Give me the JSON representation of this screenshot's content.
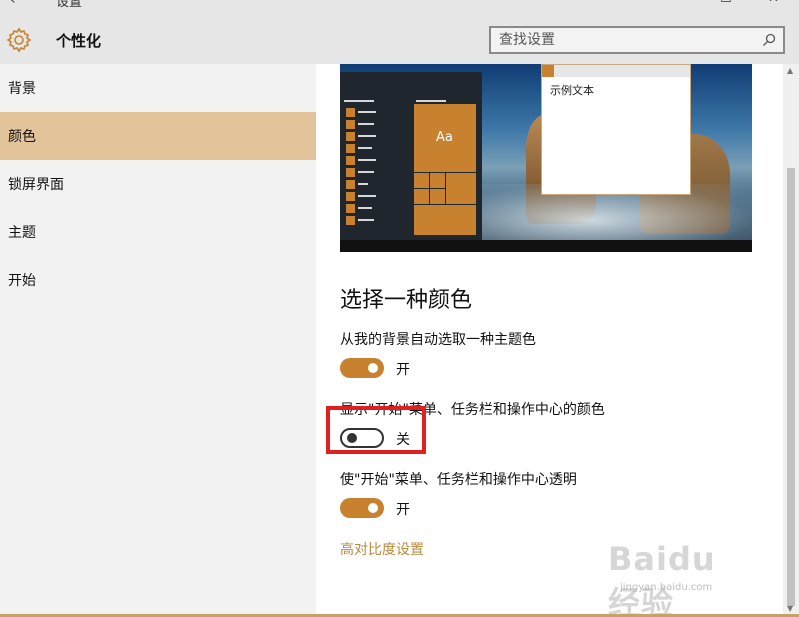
{
  "window": {
    "title": "设置",
    "back_glyph": "‹",
    "minimize_glyph": "–",
    "maximize_glyph": "☐",
    "close_glyph": "✕"
  },
  "header": {
    "app_icon": "gear-icon",
    "title": "个性化",
    "search_placeholder": "查找设置",
    "search_icon": "search-icon"
  },
  "sidebar": {
    "items": [
      {
        "label": "背景",
        "selected": false
      },
      {
        "label": "颜色",
        "selected": true
      },
      {
        "label": "锁屏界面",
        "selected": false
      },
      {
        "label": "主题",
        "selected": false
      },
      {
        "label": "开始",
        "selected": false
      }
    ]
  },
  "preview": {
    "tile_text": "Aa",
    "sample_text": "示例文本"
  },
  "main": {
    "section_title": "选择一种颜色",
    "settings": [
      {
        "label": "从我的背景自动选取一种主题色",
        "state": "开",
        "on": true
      },
      {
        "label": "显示\"开始\"菜单、任务栏和操作中心的颜色",
        "state": "关",
        "on": false
      },
      {
        "label": "使\"开始\"菜单、任务栏和操作中心透明",
        "state": "开",
        "on": true
      }
    ],
    "link_high_contrast": "高对比度设置"
  },
  "watermark": {
    "logo": "Baidu 经验",
    "url": "jingyan.baidu.com"
  },
  "colors": {
    "accent": "#c8812f",
    "selected_nav": "#e3c49a",
    "highlight_box": "#e02020",
    "link": "#b88a3d"
  }
}
